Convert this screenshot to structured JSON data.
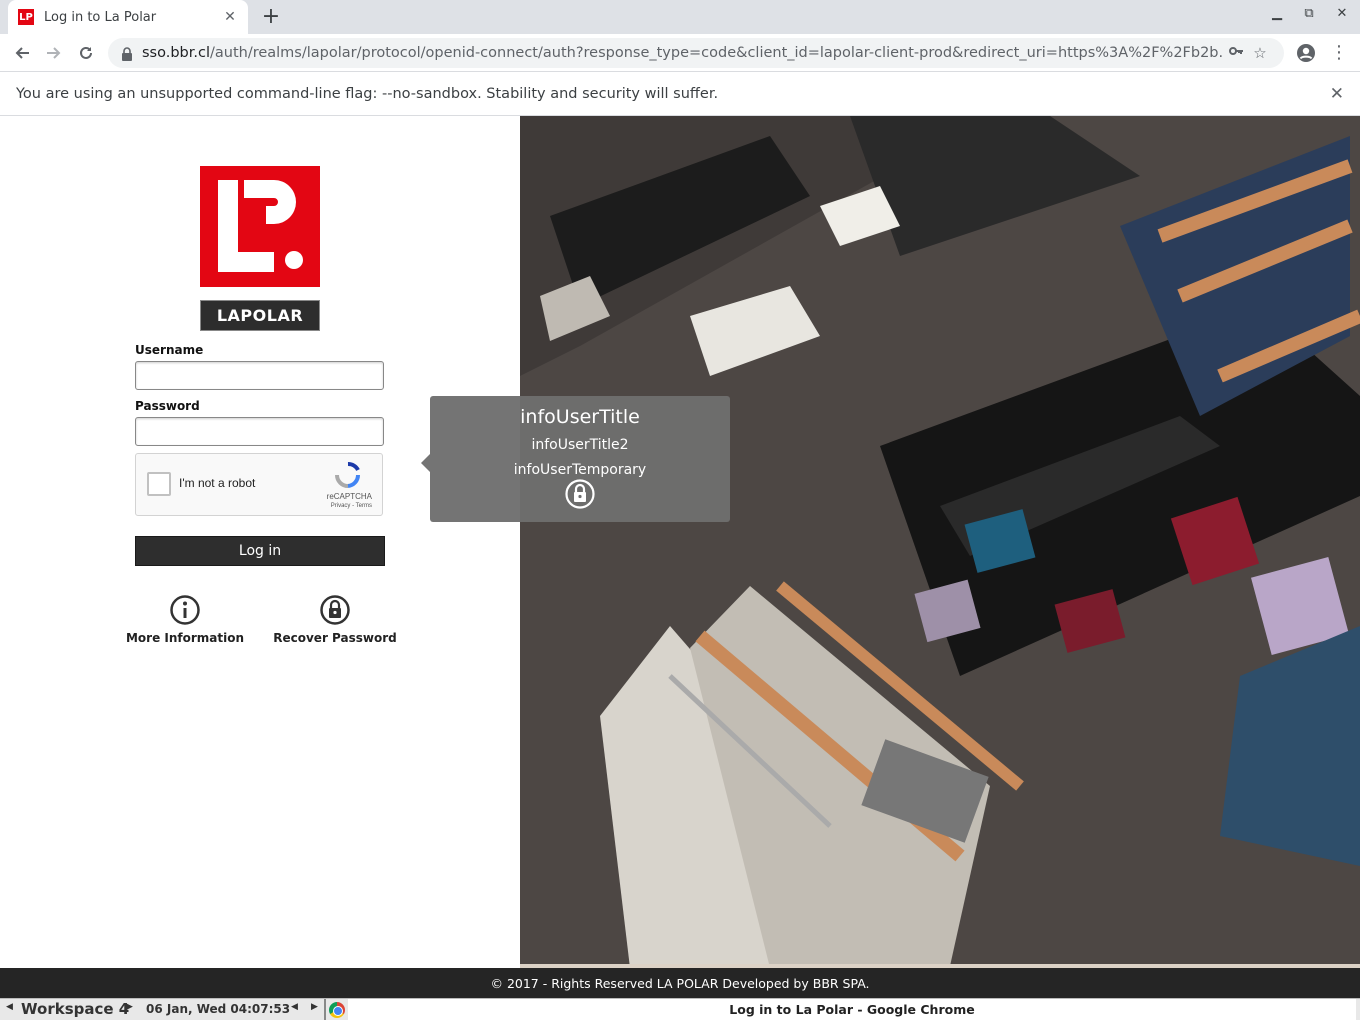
{
  "browser": {
    "tab_title": "Log in to La Polar",
    "tab_favicon_text": "LP",
    "url_host": "sso.bbr.cl",
    "url_path": "/auth/realms/lapolar/protocol/openid-connect/auth?response_type=code&client_id=lapolar-client-prod&redirect_uri=https%3A%2F%2Fb2b...",
    "infobar_text": "You are using an unsupported command-line flag: --no-sandbox. Stability and security will suffer."
  },
  "login": {
    "brand_wordmark": "LAPOLAR",
    "username_label": "Username",
    "username_value": "",
    "password_label": "Password",
    "password_value": "",
    "captcha_label": "I'm not a robot",
    "captcha_brand": "reCAPTCHA",
    "captcha_terms": "Privacy - Terms",
    "login_button": "Log in",
    "more_info_label": "More Information",
    "recover_label": "Recover Password"
  },
  "tooltip": {
    "title": "infoUserTitle",
    "subtitle": "infoUserTitle2",
    "temporary": "infoUserTemporary"
  },
  "footer": {
    "text": "© 2017 - Rights Reserved LA POLAR Developed by BBR SPA."
  },
  "taskbar": {
    "workspace": "Workspace 4",
    "clock": "06 Jan, Wed 04:07:53",
    "window_title": "Log in to La Polar - Google Chrome"
  },
  "colors": {
    "brand_red": "#e30613",
    "button_dark": "#2e2e2e",
    "footer_bg": "#252525"
  }
}
